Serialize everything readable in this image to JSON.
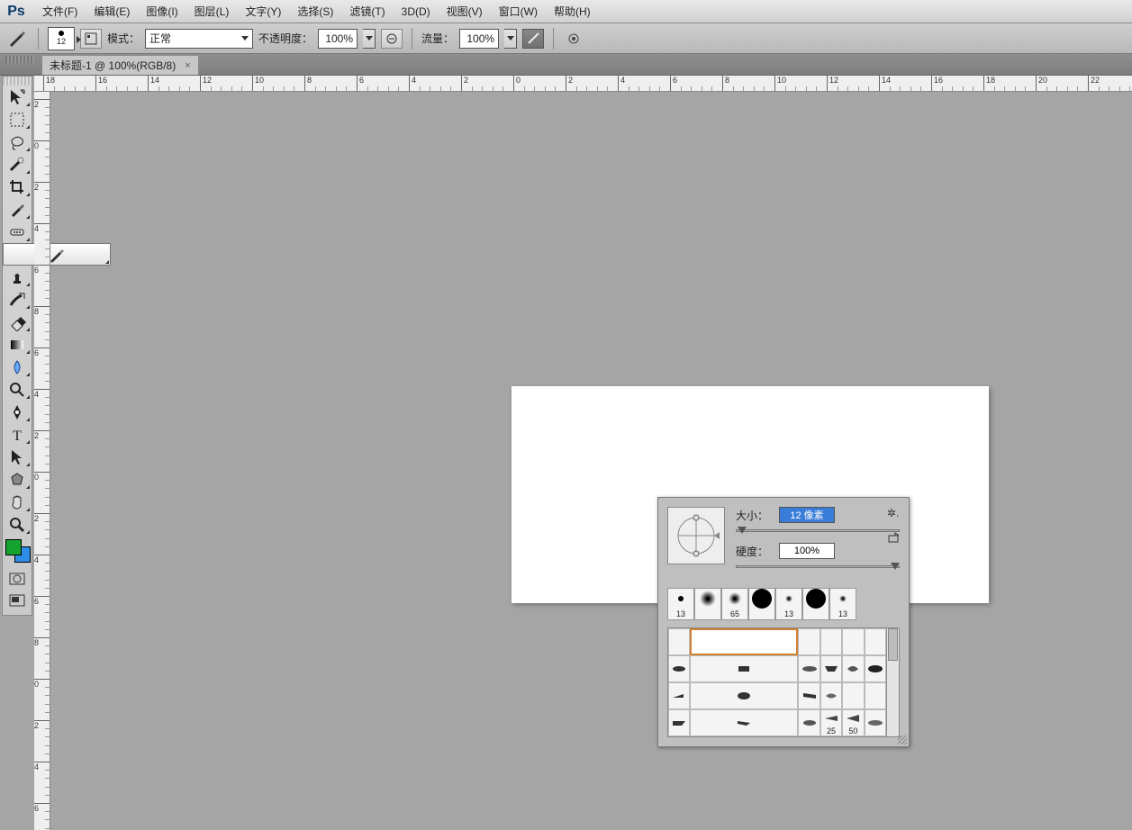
{
  "app": {
    "logo": "Ps"
  },
  "menu": [
    "文件(F)",
    "编辑(E)",
    "图像(I)",
    "图层(L)",
    "文字(Y)",
    "选择(S)",
    "滤镜(T)",
    "3D(D)",
    "视图(V)",
    "窗口(W)",
    "帮助(H)"
  ],
  "options": {
    "brush_size": "12",
    "mode_label": "模式：",
    "mode_value": "正常",
    "opacity_label": "不透明度：",
    "opacity_value": "100%",
    "flow_label": "流量：",
    "flow_value": "100%"
  },
  "tab": {
    "title": "未标题-1 @ 100%(RGB/8)",
    "close": "×"
  },
  "tools": [
    {
      "n": "move-tool"
    },
    {
      "n": "marquee-tool"
    },
    {
      "n": "lasso-tool"
    },
    {
      "n": "quick-select-tool"
    },
    {
      "n": "crop-tool"
    },
    {
      "n": "eyedropper-tool"
    },
    {
      "n": "healing-tool"
    },
    {
      "n": "pencil-tool",
      "sel": true
    },
    {
      "n": "stamp-tool"
    },
    {
      "n": "history-brush-tool"
    },
    {
      "n": "eraser-tool"
    },
    {
      "n": "gradient-tool"
    },
    {
      "n": "blur-tool"
    },
    {
      "n": "dodge-tool"
    },
    {
      "n": "pen-tool"
    },
    {
      "n": "type-tool"
    },
    {
      "n": "path-select-tool"
    },
    {
      "n": "shape-tool"
    },
    {
      "n": "hand-tool"
    },
    {
      "n": "zoom-tool"
    }
  ],
  "colors": {
    "fg": "#16a22f",
    "bg": "#2e8de6"
  },
  "ruler_h": [
    "18",
    "16",
    "14",
    "12",
    "10",
    "8",
    "6",
    "4",
    "2",
    "0",
    "2",
    "4",
    "6",
    "8",
    "10",
    "12",
    "14",
    "16",
    "18",
    "20",
    "22"
  ],
  "ruler_v": [
    "2",
    "0",
    "2",
    "4",
    "6",
    "8",
    "6",
    "4",
    "2",
    "0",
    "2",
    "4",
    "6",
    "8",
    "0",
    "2",
    "4",
    "6"
  ],
  "pencilPanel": {
    "size_label": "大小：",
    "size_value": "12 像素",
    "hard_label": "硬度：",
    "hard_value": "100%",
    "presets_top": [
      {
        "t": "hard",
        "s": 6,
        "n": "13"
      },
      {
        "t": "soft",
        "s": 18,
        "n": ""
      },
      {
        "t": "soft",
        "s": 14,
        "n": "65"
      },
      {
        "t": "hard",
        "s": 22,
        "n": ""
      },
      {
        "t": "soft",
        "s": 8,
        "n": "13"
      },
      {
        "t": "hard",
        "s": 22,
        "n": ""
      },
      {
        "t": "soft",
        "s": 8,
        "n": "13"
      }
    ],
    "grid": [
      [
        {
          "t": "soft",
          "s": 20
        },
        {
          "t": "hard",
          "s": 22,
          "sel": true
        },
        {
          "t": "soft",
          "s": 20
        },
        {
          "t": "hard",
          "s": 22
        },
        {
          "t": "soft",
          "s": 20
        },
        {
          "t": "hard",
          "s": 22
        }
      ],
      [
        {
          "t": "sp",
          "g": "a"
        },
        {
          "t": "sp",
          "g": "b"
        },
        {
          "t": "sp",
          "g": "c"
        },
        {
          "t": "sp",
          "g": "d"
        },
        {
          "t": "sp",
          "g": "e"
        },
        {
          "t": "sp",
          "g": "f"
        }
      ],
      [
        {
          "t": "sp",
          "g": "g"
        },
        {
          "t": "sp",
          "g": "h"
        },
        {
          "t": "sp",
          "g": "i"
        },
        {
          "t": "sp",
          "g": "j"
        },
        {
          "t": "soft",
          "s": 18
        },
        {
          "t": "soft",
          "s": 20
        }
      ],
      [
        {
          "t": "sp",
          "g": "k"
        },
        {
          "t": "sp",
          "g": "l"
        },
        {
          "t": "sp",
          "g": "m"
        },
        {
          "t": "sp",
          "g": "n",
          "n": "25"
        },
        {
          "t": "sp",
          "g": "o",
          "n": "50"
        },
        {
          "t": "sp",
          "g": "p"
        }
      ]
    ]
  }
}
